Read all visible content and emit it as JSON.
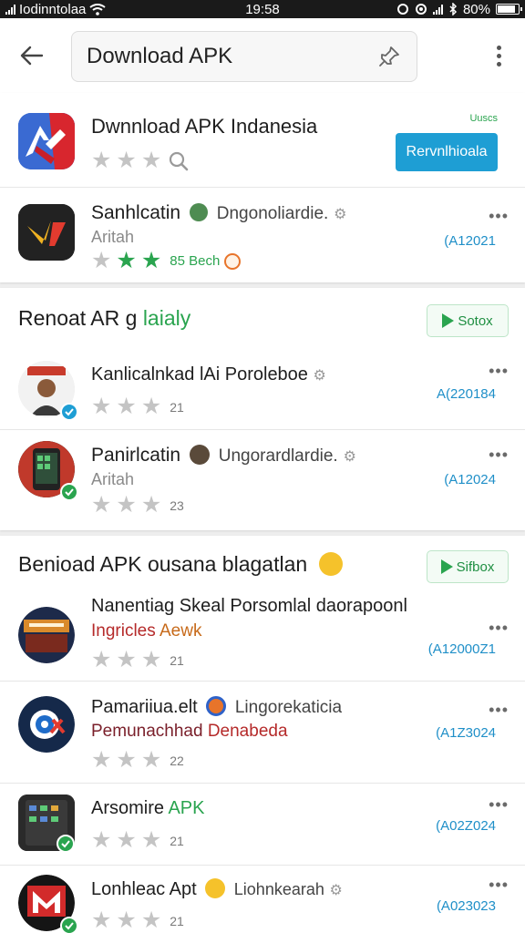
{
  "status_bar": {
    "carrier": "Iodinntolaa",
    "time": "19:58",
    "battery": "80%",
    "battery_level": 0.8
  },
  "search": {
    "value": "Download APK",
    "back_icon": "back-arrow-icon",
    "action_icon": "pin-icon",
    "menu_icon": "more-vert-icon"
  },
  "hero": {
    "title": "Dwnnload APK Indanesia",
    "tag": "Uuscs",
    "button_label": "Rervnlhioala",
    "rating": 0,
    "icon": "app-logo-icon"
  },
  "featured": {
    "title": "Sanhlcatin",
    "title_extra": "Dngonoliardie.",
    "subtitle": "Aritah",
    "rating": 3,
    "rating_text": "85 Bech",
    "date": "(A12021"
  },
  "section1": {
    "title_main": "Renoat AR g ",
    "title_accent": "laialy",
    "button_label": "Sotox",
    "items": [
      {
        "title": "Kanlicalnkad lAi Poroleboe",
        "subtitle": "",
        "count": "21",
        "date": "A(220184",
        "icon": "avatar-woman-icon"
      },
      {
        "title": "Panirlcatin",
        "title_extra": "Ungorardlardie.",
        "subtitle": "Aritah",
        "count": "23",
        "date": "(A12024",
        "icon": "phone-app-icon"
      }
    ]
  },
  "section2": {
    "title": "Benioad APK ousana blagatlan",
    "button_label": "Sifbox",
    "items": [
      {
        "title": "Nanentiag Skeal Porsomlal daorapoonl",
        "subtitle": "Ingricles",
        "subtitle_accent": "Aewk",
        "count": "21",
        "date": "(A12000Z1",
        "icon": "movie-poster-icon"
      },
      {
        "title": "Pamariiua.elt",
        "title_extra": "Lingorekaticia",
        "subtitle": "Pemunachhad",
        "subtitle_accent": "Denabeda",
        "count": "22",
        "date": "(A1Z3024",
        "icon": "target-logo-icon"
      },
      {
        "title": "Arsomire",
        "title_accent": "APK",
        "subtitle": "",
        "count": "21",
        "date": "(A02Z024",
        "icon": "phone-app-icon"
      },
      {
        "title": "Lonhleac Apt",
        "title_extra": "Liohnkearah",
        "subtitle": "",
        "count": "21",
        "date": "(A023023",
        "icon": "m-logo-icon"
      }
    ]
  },
  "colors": {
    "accent_green": "#2aa44f",
    "accent_blue": "#1e9ed4",
    "date_blue": "#1f8fc8"
  }
}
